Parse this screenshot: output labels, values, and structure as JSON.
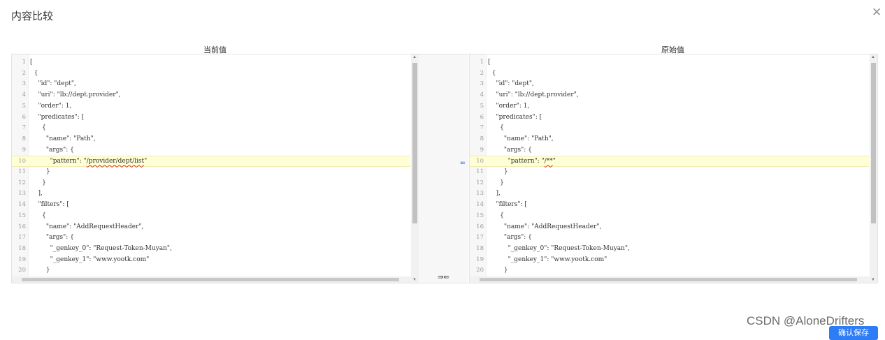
{
  "dialog": {
    "title": "内容比较",
    "close_icon": "close-icon",
    "left_title": "当前值",
    "right_title": "原始值",
    "merge_arrow_label": "⇚",
    "merge_all_label": "⇛⇚",
    "highlight_color": "#ffffd6"
  },
  "left_lines": [
    "[",
    "  {",
    "    \"id\": \"dept\",",
    "    \"uri\": \"lb://dept.provider\",",
    "    \"order\": 1,",
    "    \"predicates\": [",
    "      {",
    "        \"name\": \"Path\",",
    "        \"args\": {",
    "          \"pattern\": \"/provider/dept/list\"",
    "        }",
    "      }",
    "    ],",
    "    \"filters\": [",
    "      {",
    "        \"name\": \"AddRequestHeader\",",
    "        \"args\": {",
    "          \"_genkey_0\": \"Request-Token-Muyan\",",
    "          \"_genkey_1\": \"www.yootk.com\"",
    "        }"
  ],
  "right_lines": [
    "[",
    "  {",
    "    \"id\": \"dept\",",
    "    \"uri\": \"lb://dept.provider\",",
    "    \"order\": 1,",
    "    \"predicates\": [",
    "      {",
    "        \"name\": \"Path\",",
    "        \"args\": {",
    "          \"pattern\": \"/**\"",
    "        }",
    "      }",
    "    ],",
    "    \"filters\": [",
    "      {",
    "        \"name\": \"AddRequestHeader\",",
    "        \"args\": {",
    "          \"_genkey_0\": \"Request-Token-Muyan\",",
    "          \"_genkey_1\": \"www.yootk.com\"",
    "        }"
  ],
  "highlight_line": 10,
  "watermark": "CSDN @AloneDrifters",
  "footer_button_label": "确认保存"
}
